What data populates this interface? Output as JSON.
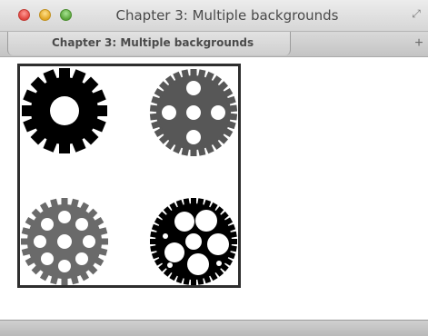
{
  "window": {
    "title": "Chapter 3: Multiple backgrounds"
  },
  "tabs": [
    {
      "label": "Chapter 3: Multiple backgrounds",
      "active": true
    }
  ],
  "toolbar": {
    "new_tab_glyph": "+",
    "fullscreen_glyph": "⤢"
  },
  "icons": {
    "close": "close-button",
    "minimize": "minimize-button",
    "maximize": "zoom-button",
    "gears": [
      "gear-icon-black",
      "gear-icon-gray-spoked",
      "gear-icon-gray-holes",
      "gear-icon-black-large-holes"
    ]
  },
  "colors": {
    "gear_black": "#000000",
    "gear_gray": "#5a5a5a",
    "frame_border": "#2e2e2e"
  }
}
